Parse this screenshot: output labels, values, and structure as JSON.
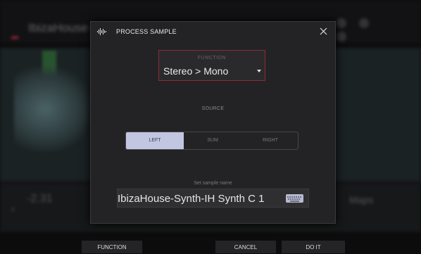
{
  "background": {
    "title": "IbizaHouse-Sy",
    "value": "-2.31",
    "right_label": "Maps"
  },
  "dialog": {
    "title": "PROCESS SAMPLE",
    "icons": {
      "header": "waveform-icon",
      "close": "close-icon"
    },
    "function": {
      "label": "FUNCTION",
      "value": "Stereo > Mono",
      "icon": "caret-down-icon"
    },
    "source": {
      "label": "SOURCE",
      "options": [
        "LEFT",
        "SUM",
        "RIGHT"
      ],
      "selected": "LEFT"
    },
    "sample_name": {
      "label": "Set sample name",
      "value": "IbizaHouse-Synth-IH Synth C 1",
      "icon": "keyboard-icon"
    }
  },
  "bottom_bar": {
    "function_label": "FUNCTION",
    "cancel_label": "CANCEL",
    "doit_label": "DO IT"
  },
  "colors": {
    "accent_red": "#8a2b3a",
    "selected_segment": "#c3c6e0",
    "dialog_bg": "#232325"
  }
}
